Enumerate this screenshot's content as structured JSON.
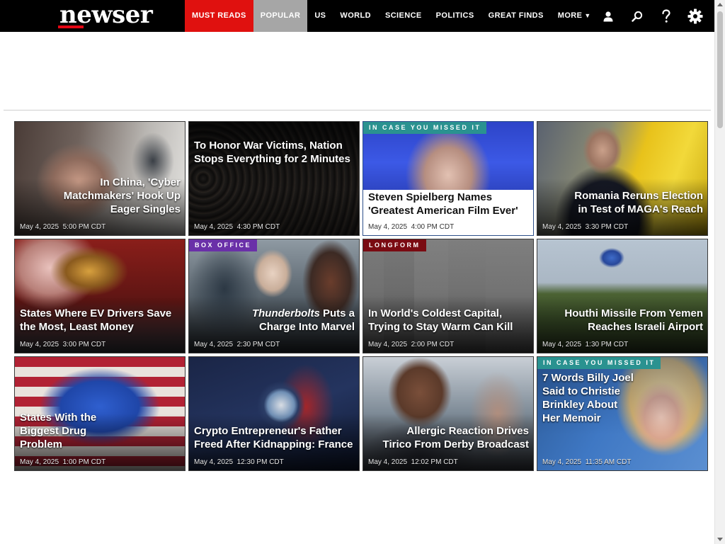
{
  "logo": {
    "text": "newser",
    "accent": "#e30613"
  },
  "nav": {
    "items": [
      {
        "label": "MUST READS",
        "style": "red"
      },
      {
        "label": "POPULAR",
        "style": "gray"
      },
      {
        "label": "US",
        "style": ""
      },
      {
        "label": "WORLD",
        "style": ""
      },
      {
        "label": "SCIENCE",
        "style": ""
      },
      {
        "label": "POLITICS",
        "style": ""
      },
      {
        "label": "GREAT FINDS",
        "style": ""
      },
      {
        "label": "MORE",
        "style": ""
      }
    ],
    "icons": [
      "user-icon",
      "search-icon",
      "help-icon",
      "gear-icon"
    ]
  },
  "stories": [
    {
      "headline": "In China, 'Cyber Matchmakers' Hook Up Eager Singles",
      "date": "May 4, 2025",
      "time": "5:00 PM CDT"
    },
    {
      "headline": "To Honor War Victims, Nation Stops Everything for 2 Minutes",
      "date": "May 4, 2025",
      "time": "4:30 PM CDT"
    },
    {
      "badge": "IN CASE YOU MISSED IT",
      "headline": "Steven Spielberg Names 'Greatest American Film Ever'",
      "date": "May 4, 2025",
      "time": "4:00 PM CDT"
    },
    {
      "headline": "Romania Reruns Election in Test of MAGA's Reach",
      "date": "May 4, 2025",
      "time": "3:30 PM CDT"
    },
    {
      "headline": "States Where EV Drivers Save the Most, Least Money",
      "date": "May 4, 2025",
      "time": "3:00 PM CDT"
    },
    {
      "badge": "BOX OFFICE",
      "headline_italic": "Thunderbolts",
      "headline": " Puts a Charge Into Marvel",
      "date": "May 4, 2025",
      "time": "2:30 PM CDT"
    },
    {
      "badge": "LONGFORM",
      "headline": "In World's Coldest Capital, Trying to Stay Warm Can Kill",
      "date": "May 4, 2025",
      "time": "2:00 PM CDT"
    },
    {
      "headline": "Houthi Missile From Yemen Reaches Israeli Airport",
      "date": "May 4, 2025",
      "time": "1:30 PM CDT"
    },
    {
      "headline": "States With the Biggest Drug Problem",
      "date": "May 4, 2025",
      "time": "1:00 PM CDT"
    },
    {
      "headline": "Crypto Entrepreneur's Father Freed After Kidnapping: France",
      "date": "May 4, 2025",
      "time": "12:30 PM CDT"
    },
    {
      "headline": "Allergic Reaction Drives Tirico From Derby Broadcast",
      "date": "May 4, 2025",
      "time": "12:02 PM CDT"
    },
    {
      "badge": "IN CASE YOU MISSED IT",
      "headline": "7 Words Billy Joel Said to Christie Brinkley About Her Memoir",
      "date": "May 4, 2025",
      "time": "11:35 AM CDT"
    }
  ]
}
